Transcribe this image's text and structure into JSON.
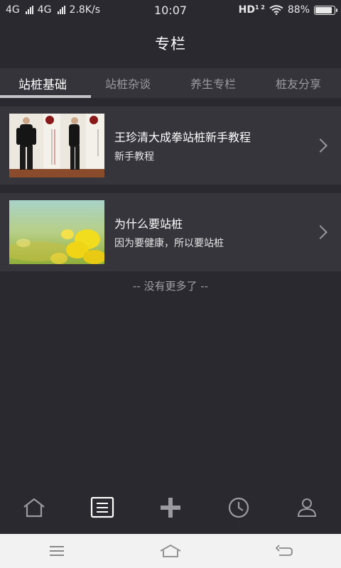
{
  "status_bar": {
    "network1": "4G",
    "network2": "4G",
    "speed": "2.8K/s",
    "time": "10:07",
    "hd": "HD",
    "hd_sub": "1 2",
    "battery_text": "88%",
    "battery_level": 0.88
  },
  "header": {
    "title": "专栏"
  },
  "tabs": [
    {
      "label": "站桩基础",
      "active": true
    },
    {
      "label": "站桩杂谈"
    },
    {
      "label": "养生专栏"
    },
    {
      "label": "桩友分享"
    }
  ],
  "articles": [
    {
      "title": "王珍清大成拳站桩新手教程",
      "subtitle": "新手教程",
      "thumb": "man-standing-photo"
    },
    {
      "title": "为什么要站桩",
      "subtitle": "因为要健康，所以要站桩",
      "thumb": "yellow-flower-photo"
    }
  ],
  "end_note": "-- 没有更多了 --",
  "bottom_nav": [
    {
      "icon": "home-icon"
    },
    {
      "icon": "article-list-icon",
      "active": true
    },
    {
      "icon": "plus-icon"
    },
    {
      "icon": "clock-icon"
    },
    {
      "icon": "user-icon"
    }
  ],
  "system_bar": [
    {
      "icon": "menu-icon"
    },
    {
      "icon": "home-outline-icon"
    },
    {
      "icon": "back-icon"
    }
  ],
  "colors": {
    "background": "#2a2930",
    "card": "#36353c",
    "tabs_bg": "#35343b",
    "text": "#ffffff",
    "muted": "#9a9aa0"
  }
}
